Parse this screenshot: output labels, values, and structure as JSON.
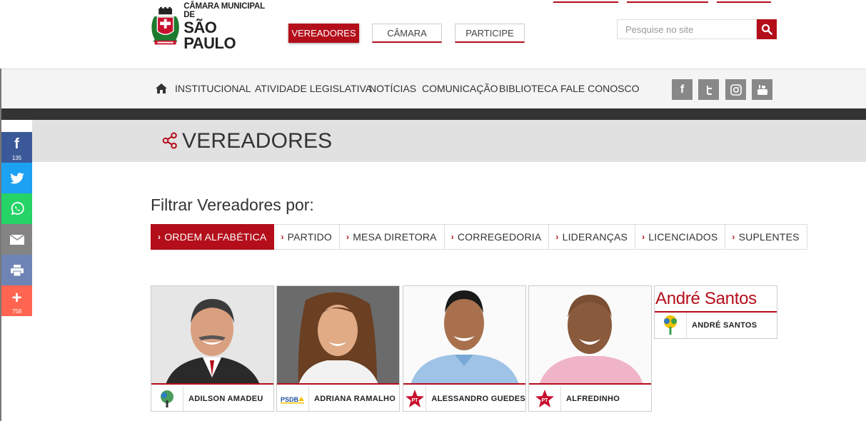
{
  "logo": {
    "line1": "CÂMARA MUNICIPAL DE",
    "line2": "SÃO PAULO"
  },
  "top_buttons": {
    "vereadores": "VEREADORES",
    "camara": "CÂMARA",
    "participe": "PARTICIPE"
  },
  "search": {
    "placeholder": "Pesquise no site"
  },
  "nav": {
    "items": [
      "INSTITUCIONAL",
      "ATIVIDADE LEGISLATIVA",
      "NOTÍCIAS",
      "COMUNICAÇÃO",
      "BIBLIOTECA",
      "FALE CONOSCO"
    ]
  },
  "social_icons": [
    "facebook-icon",
    "twitter-icon",
    "instagram-icon",
    "youtube-icon"
  ],
  "page_title": "VEREADORES",
  "share_bar": {
    "facebook_count": "135",
    "more_count": "758",
    "colors": {
      "facebook": "#3b5998",
      "twitter": "#1da1f2",
      "whatsapp": "#25d366",
      "email": "#848484",
      "print": "#6d84b4",
      "more": "#ff6550"
    }
  },
  "filter": {
    "label": "Filtrar Vereadores por:",
    "tabs": [
      "ORDEM ALFABÉTICA",
      "PARTIDO",
      "MESA DIRETORA",
      "CORREGEDORIA",
      "LIDERANÇAS",
      "LICENCIADOS",
      "SUPLENTES"
    ],
    "active": "ORDEM ALFABÉTICA"
  },
  "councillors": [
    {
      "name": "ADILSON AMADEU",
      "party": "PTB"
    },
    {
      "name": "ADRIANA RAMALHO",
      "party": "PSDB"
    },
    {
      "name": "ALESSANDRO GUEDES",
      "party": "PT"
    },
    {
      "name": "ALFREDINHO",
      "party": "PT"
    }
  ],
  "andre": {
    "heading": "André Santos",
    "name": "ANDRÉ SANTOS"
  },
  "party_labels": {
    "psdb": "PSDB",
    "pt": "PT"
  },
  "colors": {
    "brand_red": "#b30e1a"
  }
}
